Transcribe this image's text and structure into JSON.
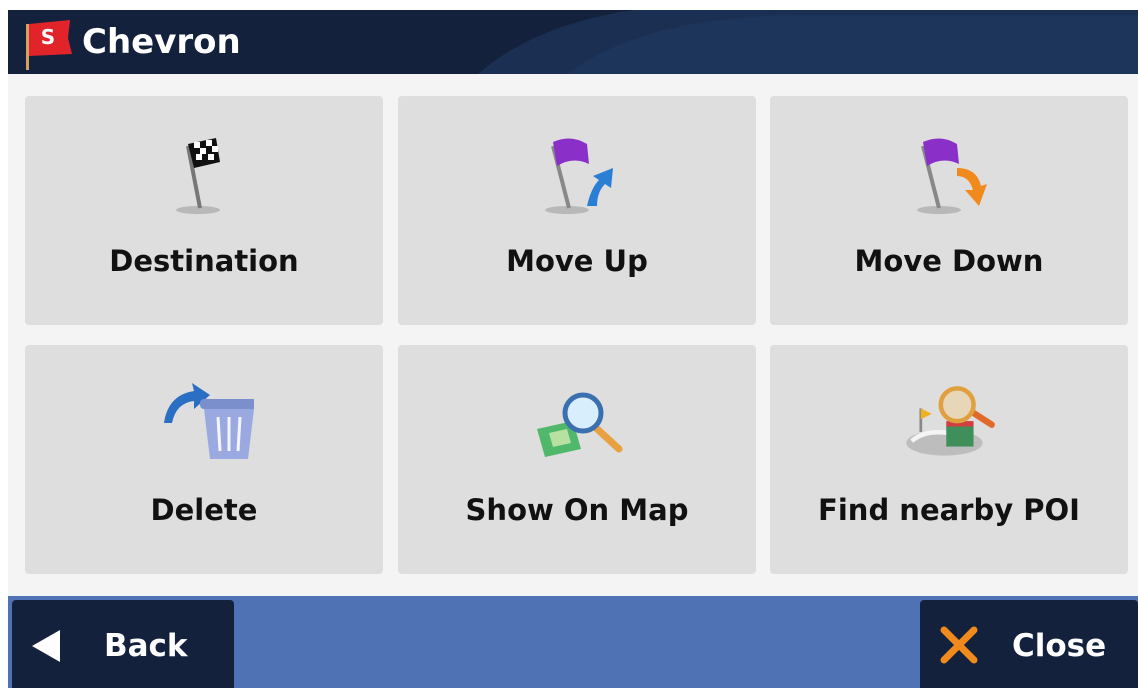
{
  "header": {
    "title": "Chevron",
    "flag_letter": "S"
  },
  "tiles": [
    {
      "label": "Destination",
      "icon": "checkered-flag-icon"
    },
    {
      "label": "Move Up",
      "icon": "flag-arrow-up-icon"
    },
    {
      "label": "Move Down",
      "icon": "flag-arrow-down-icon"
    },
    {
      "label": "Delete",
      "icon": "trash-arrow-icon"
    },
    {
      "label": "Show On Map",
      "icon": "map-magnifier-icon"
    },
    {
      "label": "Find nearby POI",
      "icon": "poi-search-icon"
    }
  ],
  "footer": {
    "back_label": "Back",
    "close_label": "Close"
  },
  "colors": {
    "header_bg": "#13213c",
    "footer_bg": "#4f72b5",
    "tile_bg": "#dedede",
    "accent_purple": "#8b2fc9",
    "accent_orange": "#f08a1c",
    "accent_blue": "#2a7fd4"
  }
}
